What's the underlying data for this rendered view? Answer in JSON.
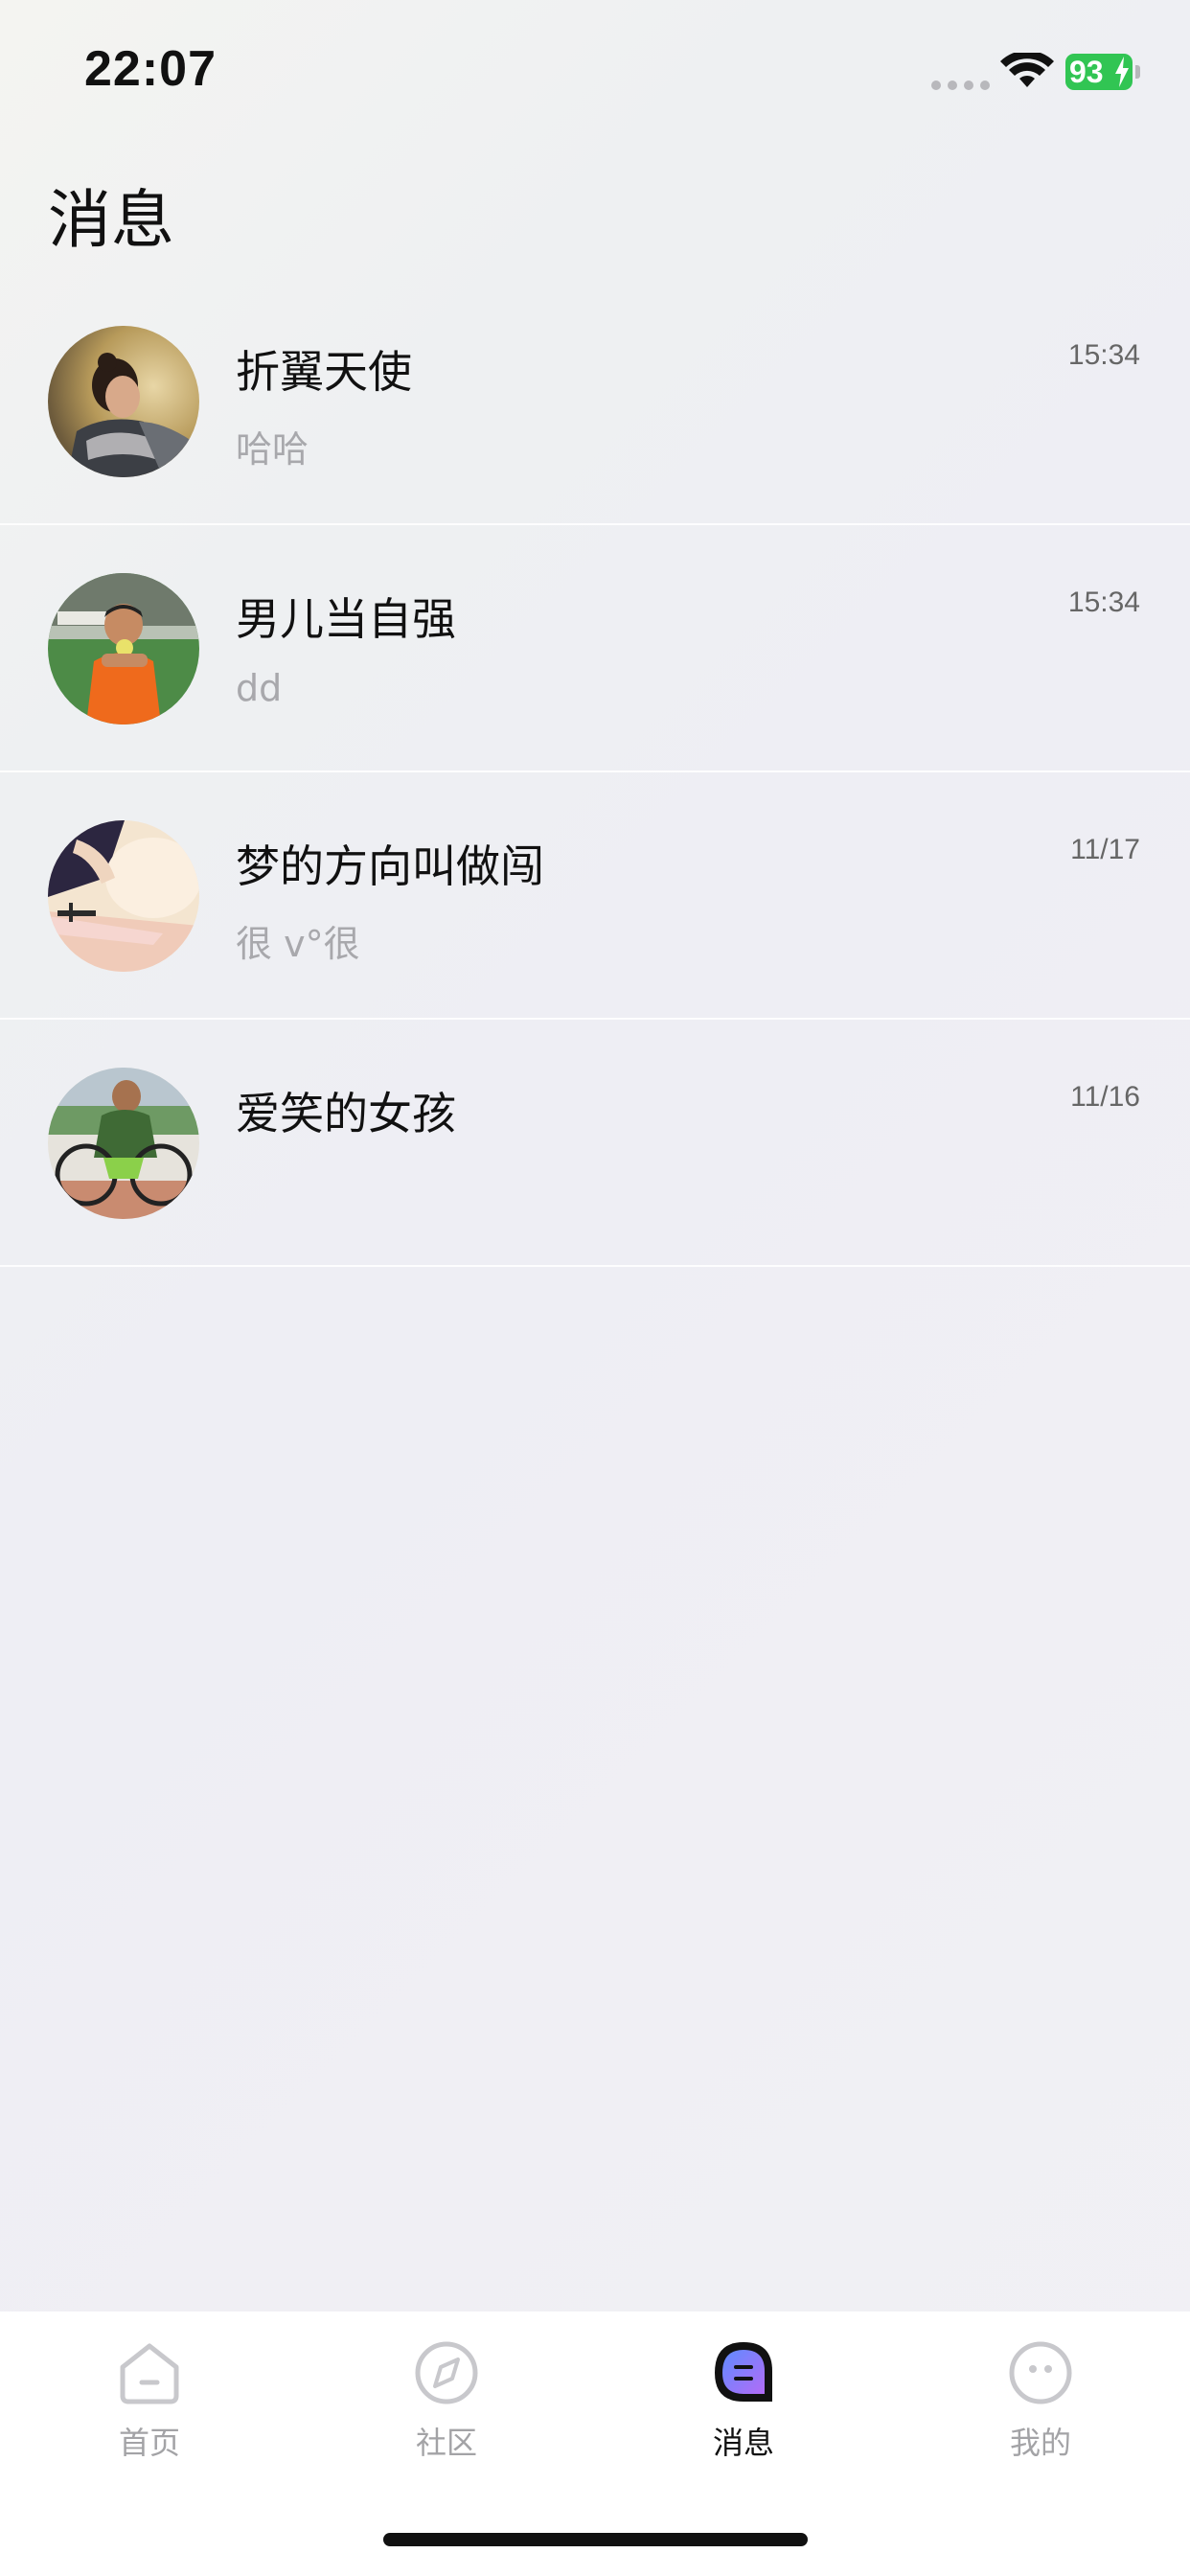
{
  "status_bar": {
    "time": "22:07",
    "battery_level": "93",
    "icons": [
      "signal-icon",
      "wifi-icon",
      "battery-charging-icon"
    ],
    "battery_color": "#31c553"
  },
  "page": {
    "title": "消息"
  },
  "conversations": [
    {
      "name": "折翼天使",
      "preview": "哈哈",
      "time": "15:34",
      "avatar": "woman-portrait-avatar"
    },
    {
      "name": "男儿当自强",
      "preview": "dd",
      "time": "15:34",
      "avatar": "baseball-player-avatar"
    },
    {
      "name": "梦的方向叫做闯",
      "preview": "很 v°很",
      "time": "11/17",
      "avatar": "painting-avatar"
    },
    {
      "name": "爱笑的女孩",
      "preview": "",
      "time": "11/16",
      "avatar": "wheelchair-athlete-avatar"
    }
  ],
  "tab_bar": {
    "items": [
      {
        "label": "首页",
        "icon": "home-icon",
        "active": false
      },
      {
        "label": "社区",
        "icon": "compass-icon",
        "active": false
      },
      {
        "label": "消息",
        "icon": "message-icon",
        "active": true
      },
      {
        "label": "我的",
        "icon": "profile-face-icon",
        "active": false
      }
    ],
    "active_color": "#7b6cf6",
    "inactive_color": "#c8c8cc"
  }
}
